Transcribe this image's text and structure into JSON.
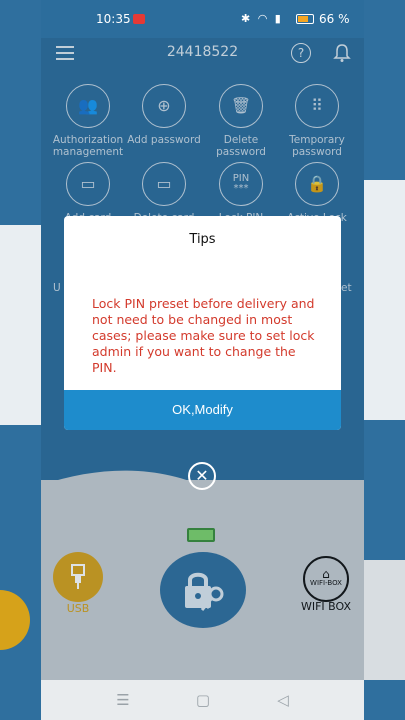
{
  "status_bar": {
    "time": "10:35",
    "battery_percent": "66 %"
  },
  "header": {
    "title": "24418522"
  },
  "grid": [
    {
      "label_line1": "Authorization",
      "label_line2": "management",
      "icon": "users-icon"
    },
    {
      "label_line1": "Add password",
      "label_line2": "",
      "icon": "keypad-add-icon"
    },
    {
      "label_line1": "Delete",
      "label_line2": "password",
      "icon": "keypad-delete-icon"
    },
    {
      "label_line1": "Temporary",
      "label_line2": "password",
      "icon": "keypad-temp-icon"
    },
    {
      "label_line1": "Add card",
      "label_line2": "",
      "icon": "card-add-icon"
    },
    {
      "label_line1": "Delete card",
      "label_line2": "",
      "icon": "card-delete-icon"
    },
    {
      "label_line1": "Lock PIN",
      "label_line2": "",
      "icon": "pin-icon",
      "icon_text": "PIN\n***"
    },
    {
      "label_line1": "Active Lock",
      "label_line2": "",
      "icon": "active-lock-icon"
    }
  ],
  "peek": {
    "left": "U",
    "right": "et"
  },
  "dialog": {
    "title": "Tips",
    "message": "Lock PIN preset before delivery and not need to be changed in most cases; please make sure to set lock admin if you want to change the PIN.",
    "button": "OK,Modify"
  },
  "bottom": {
    "usb_label": "USB",
    "wifi_label": "WIFI BOX",
    "wifi_icon_text": "WIFI-BOX"
  },
  "colors": {
    "accent": "#1e8ccc",
    "warning_text": "#d33a2c",
    "usb_yellow": "#d6a21a"
  }
}
